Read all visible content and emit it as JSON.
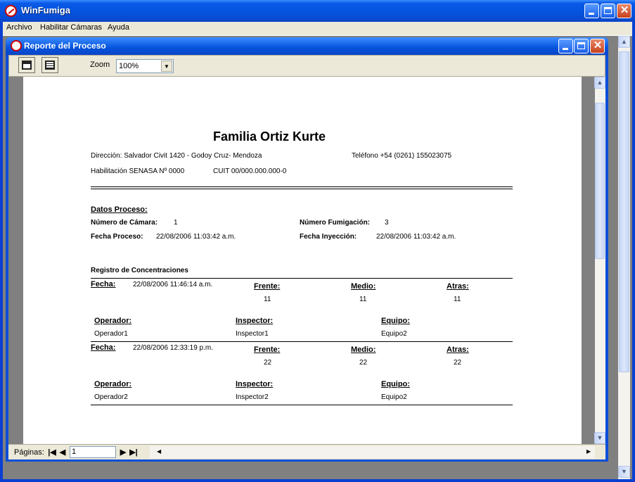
{
  "app": {
    "title": "WinFumiga"
  },
  "menu": {
    "items": [
      "Archivo",
      "Habilitar Cámaras",
      "Ayuda"
    ]
  },
  "child": {
    "title": "Reporte del Proceso"
  },
  "toolbar": {
    "zoom_label": "Zoom",
    "zoom_value": "100%"
  },
  "report": {
    "company": "Familia Ortiz Kurte",
    "address": "Dirección: Salvador Civit 1420 - Godoy Cruz- Mendoza",
    "phone": "Teléfono +54 (0261) 155023075",
    "senasa": "Habilitación SENASA Nº 0000",
    "cuit": "CUIT 00/000.000.000-0",
    "section_title": "Datos Proceso:",
    "camara_label": "Número de Cámara:",
    "camara_value": "1",
    "fumigacion_label": "Número Fumigación:",
    "fumigacion_value": "3",
    "fecha_proceso_label": "Fecha Proceso:",
    "fecha_proceso_value": "22/08/2006 11:03:42 a.m.",
    "fecha_inyeccion_label": "Fecha Inyección:",
    "fecha_inyeccion_value": "22/08/2006 11:03:42 a.m.",
    "registro_title": "Registro de Concentraciones",
    "labels": {
      "fecha": "Fecha:",
      "frente": "Frente:",
      "medio": "Medio:",
      "atras": "Atras:",
      "operador": "Operador:",
      "inspector": "Inspector:",
      "equipo": "Equipo:"
    },
    "records": [
      {
        "fecha": "22/08/2006 11:46:14 a.m.",
        "frente": "11",
        "medio": "11",
        "atras": "11",
        "operador": "Operador1",
        "inspector": "Inspector1",
        "equipo": "Equipo2"
      },
      {
        "fecha": "22/08/2006 12:33:19 p.m.",
        "frente": "22",
        "medio": "22",
        "atras": "22",
        "operador": "Operador2",
        "inspector": "Inspector2",
        "equipo": "Equipo2"
      }
    ]
  },
  "status": {
    "pages_label": "Páginas:",
    "page_value": "1"
  },
  "icons": {
    "app": "fumigation-app-icon",
    "print": "print-icon",
    "export": "export-icon"
  }
}
